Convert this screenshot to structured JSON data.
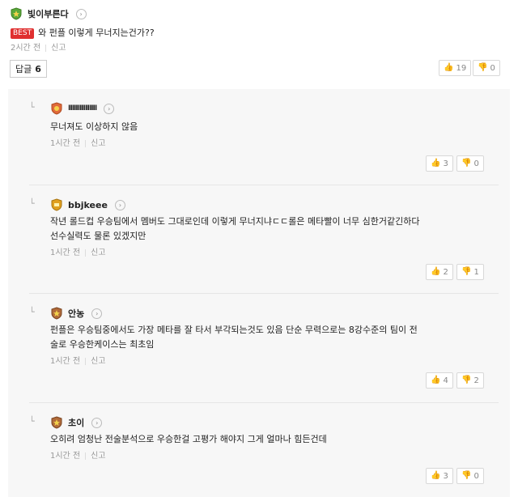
{
  "post": {
    "author": "빛이부른다",
    "badge": "BEST",
    "title": "와 펀플 이렇게 무너지는건가??",
    "time": "2시간 전",
    "report": "신고",
    "likes": "19",
    "dislikes": "0",
    "reply_label": "답글",
    "reply_count": "6"
  },
  "replies": [
    {
      "author": "IIIIIIIIIIIIIII",
      "lines": [
        "무너져도 이상하지 않음"
      ],
      "time": "1시간 전",
      "report": "신고",
      "likes": "3",
      "dislikes": "0",
      "badge_color": "#e06a3a"
    },
    {
      "author": "bbjkeee",
      "lines": [
        "작년 롤드컵 우승팀에서 멤버도 그대로인데 이렇게 무너지냐ㄷㄷ롤은 메타빨이 너무 심한거같긴하다",
        "선수실력도 물론 있겠지만"
      ],
      "time": "1시간 전",
      "report": "신고",
      "likes": "2",
      "dislikes": "1",
      "badge_color": "#e0a020"
    },
    {
      "author": "안농",
      "lines": [
        "펀플은 우승팀중에서도 가장 메타를 잘 타서 부각되는것도 있음 단순 무력으로는 8강수준의 팀이 전",
        "술로 우승한케이스는 최초임"
      ],
      "time": "1시간 전",
      "report": "신고",
      "likes": "4",
      "dislikes": "2",
      "badge_color": "#b06a3a"
    },
    {
      "author": "초이",
      "lines": [
        "오히려 엄청난 전술분석으로 우승한걸 고평가 해야지 그게 얼마나 힘든건데"
      ],
      "time": "1시간 전",
      "report": "신고",
      "likes": "3",
      "dislikes": "0",
      "badge_color": "#b06a3a"
    }
  ],
  "icons": {
    "like": "thumbs-up-icon",
    "dislike": "thumbs-down-icon",
    "chevron": "chevron-right-icon",
    "rank": "rank-badge-icon",
    "reply_hook": "reply-arrow-icon"
  }
}
